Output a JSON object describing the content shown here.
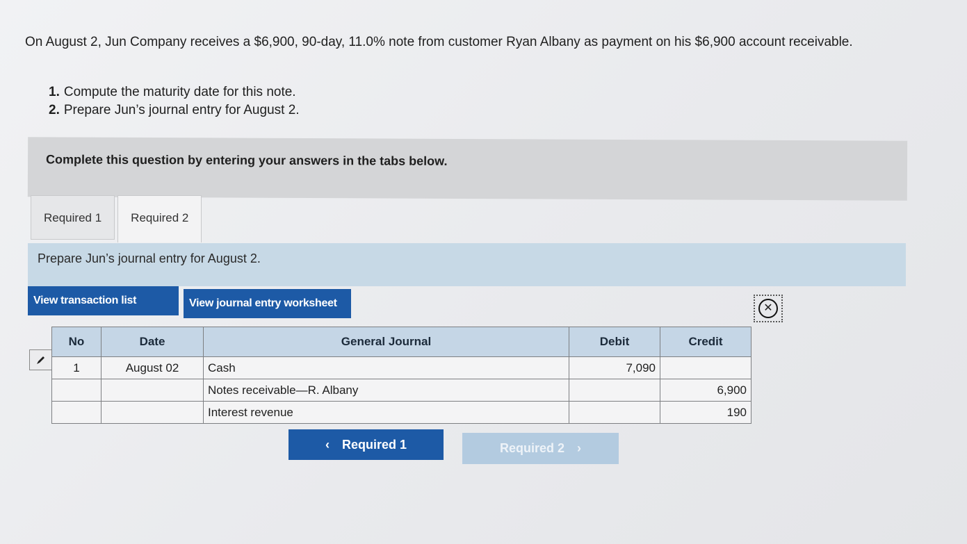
{
  "problem": {
    "text": "On August 2, Jun Company receives a $6,900, 90-day, 11.0% note from customer Ryan Albany as payment on his $6,900 account receivable.",
    "steps": [
      {
        "num": "1.",
        "text": "Compute the maturity date for this note."
      },
      {
        "num": "2.",
        "text": "Prepare Jun’s journal entry for August 2."
      }
    ]
  },
  "instructions": "Complete this question by entering your answers in the tabs below.",
  "tabs": [
    {
      "label": "Required 1",
      "active": false
    },
    {
      "label": "Required 2",
      "active": true
    }
  ],
  "prompt": "Prepare Jun’s journal entry for August 2.",
  "buttons": {
    "transaction_list": "View transaction list",
    "journal_worksheet": "View journal entry worksheet"
  },
  "journal": {
    "headers": {
      "no": "No",
      "date": "Date",
      "general_journal": "General Journal",
      "debit": "Debit",
      "credit": "Credit"
    },
    "rows": [
      {
        "no": "1",
        "date": "August 02",
        "account": "Cash",
        "debit": "7,090",
        "credit": ""
      },
      {
        "no": "",
        "date": "",
        "account": "Notes receivable—R. Albany",
        "debit": "",
        "credit": "6,900"
      },
      {
        "no": "",
        "date": "",
        "account": "Interest revenue",
        "debit": "",
        "credit": "190"
      }
    ]
  },
  "nav": {
    "prev_label": "Required 1",
    "prev_icon": "chevron-left-icon",
    "next_label": "Required 2",
    "next_icon": "chevron-right-icon"
  },
  "icons": {
    "close": "close-circle-icon",
    "edit": "pencil-icon"
  },
  "colors": {
    "primary_button": "#1d5aa6",
    "disabled_button": "#b3cbe0",
    "table_header": "#c5d6e6",
    "prompt_bar": "#c7d9e6"
  }
}
